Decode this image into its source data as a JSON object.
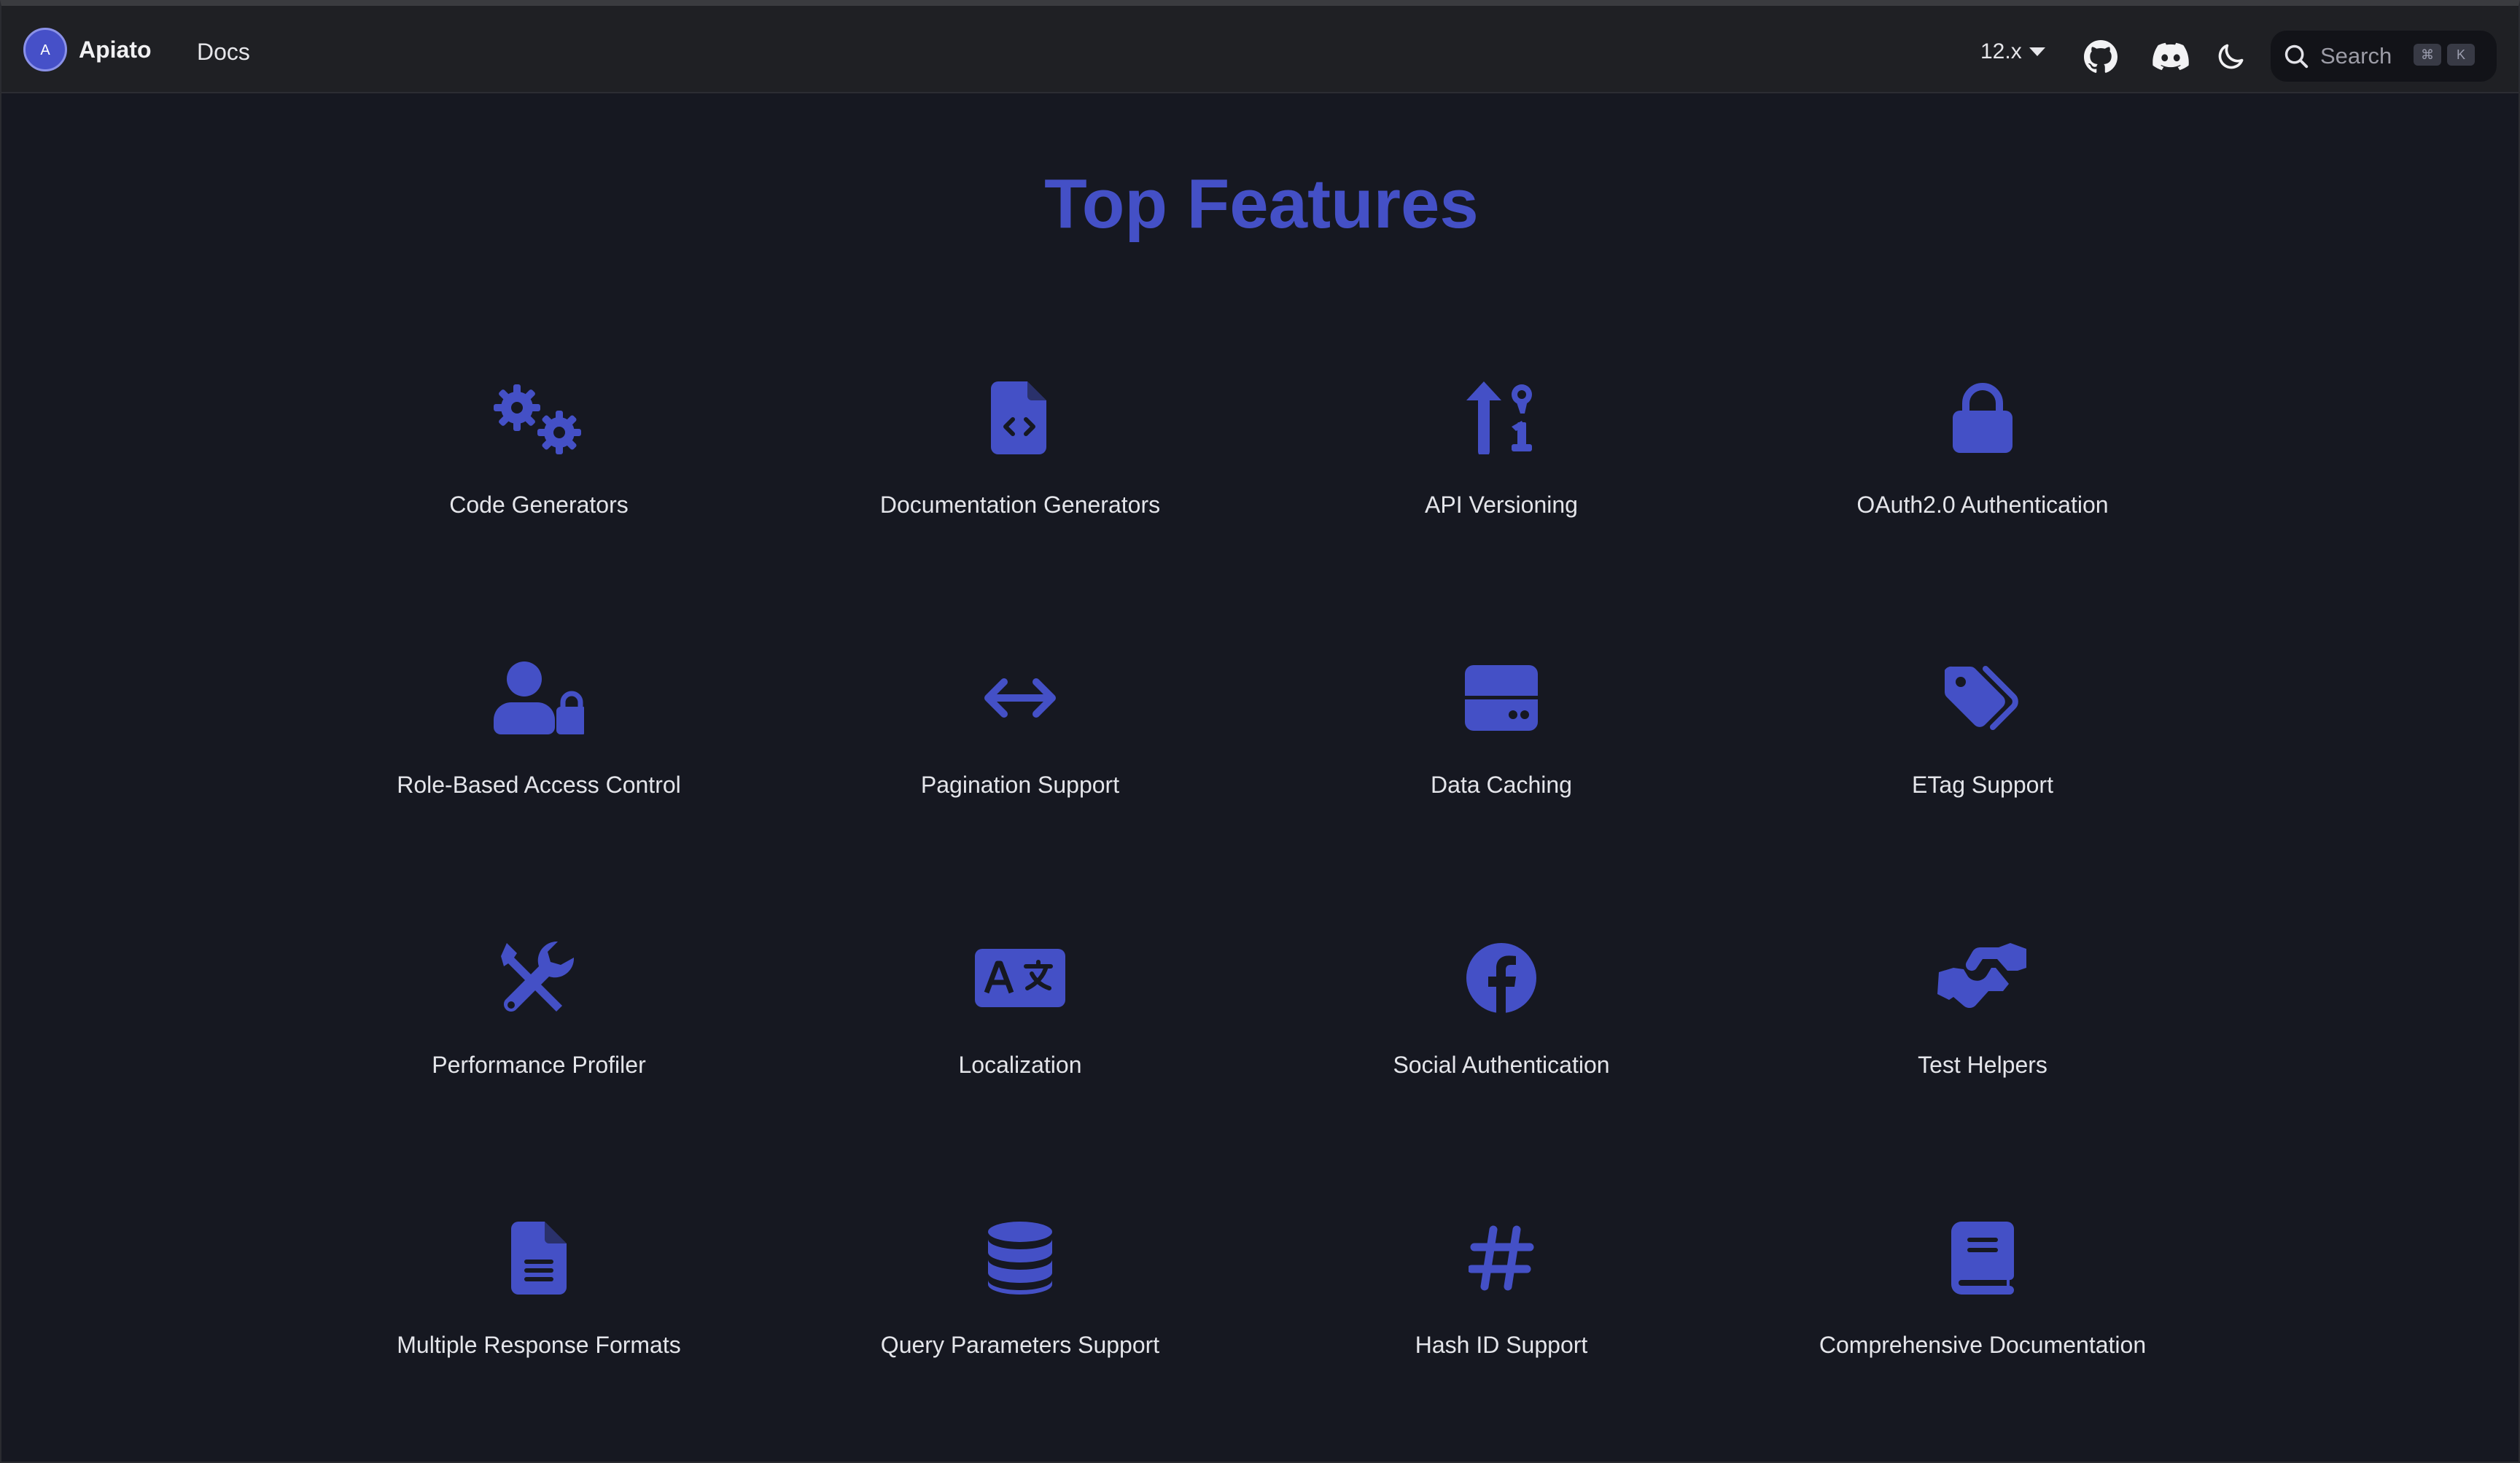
{
  "navbar": {
    "brand_name": "Apiato",
    "brand_logo_letter": "A",
    "docs_link": "Docs",
    "version": "12.x",
    "icons": [
      "github-icon",
      "discord-icon",
      "moon-icon"
    ],
    "search": {
      "label": "Search",
      "shortcut_keys": [
        "⌘",
        "K"
      ]
    }
  },
  "main": {
    "title": "Top Features",
    "accent_color": "#4450c6",
    "features": [
      {
        "label": "Code Generators",
        "icon": "cogs-icon"
      },
      {
        "label": "Documentation Generators",
        "icon": "file-code-icon"
      },
      {
        "label": "API Versioning",
        "icon": "arrow-up-1-9-icon"
      },
      {
        "label": "OAuth2.0 Authentication",
        "icon": "lock-icon"
      },
      {
        "label": "Role-Based Access Control",
        "icon": "user-lock-icon"
      },
      {
        "label": "Pagination Support",
        "icon": "arrows-left-right-icon"
      },
      {
        "label": "Data Caching",
        "icon": "hard-drive-icon"
      },
      {
        "label": "ETag Support",
        "icon": "tags-icon"
      },
      {
        "label": "Performance Profiler",
        "icon": "screwdriver-wrench-icon"
      },
      {
        "label": "Localization",
        "icon": "language-icon"
      },
      {
        "label": "Social Authentication",
        "icon": "facebook-icon"
      },
      {
        "label": "Test Helpers",
        "icon": "handshake-icon"
      },
      {
        "label": "Multiple Response Formats",
        "icon": "file-lines-icon"
      },
      {
        "label": "Query Parameters Support",
        "icon": "database-icon"
      },
      {
        "label": "Hash ID Support",
        "icon": "hashtag-icon"
      },
      {
        "label": "Comprehensive Documentation",
        "icon": "book-icon"
      }
    ]
  }
}
